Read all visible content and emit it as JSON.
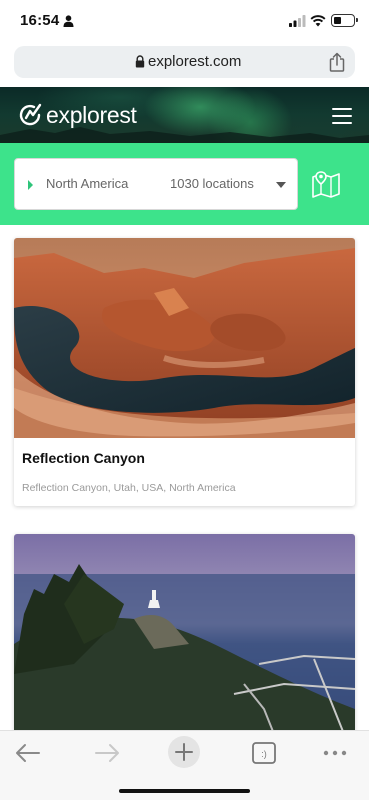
{
  "status_bar": {
    "time": "16:54",
    "icons": [
      "person-icon",
      "signal-icon",
      "wifi-icon",
      "battery-icon"
    ],
    "battery_level": 0.3
  },
  "browser": {
    "url": "explorest.com",
    "icons": [
      "lock-icon",
      "share-icon"
    ]
  },
  "header": {
    "logo_text": "explorest",
    "icons": [
      "logo-icon",
      "menu-icon"
    ]
  },
  "filter": {
    "region": "North America",
    "count_label": "1030 locations",
    "icons": [
      "caret-right-icon",
      "chevron-down-icon",
      "map-icon"
    ],
    "accent_color": "#3de38b"
  },
  "cards": [
    {
      "title": "Reflection Canyon",
      "subtitle": "Reflection Canyon, Utah, USA, North America"
    },
    {
      "title": "",
      "subtitle": ""
    }
  ],
  "toolbar": {
    "icons": [
      "back-icon",
      "forward-icon",
      "new-tab-icon",
      "tabs-icon",
      "more-icon"
    ]
  }
}
